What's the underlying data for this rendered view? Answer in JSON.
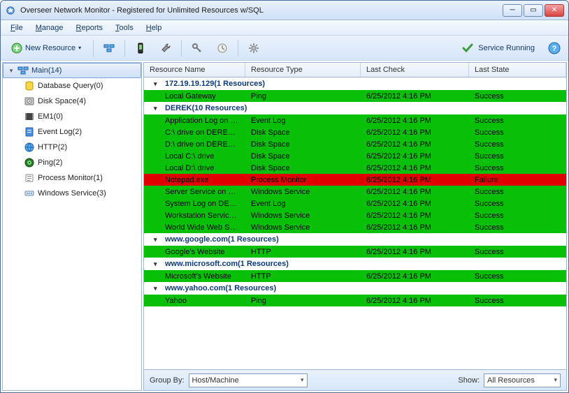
{
  "window": {
    "title": "Overseer Network Monitor - Registered for Unlimited Resources w/SQL"
  },
  "menu": {
    "file": "File",
    "manage": "Manage",
    "reports": "Reports",
    "tools": "Tools",
    "help": "Help"
  },
  "toolbar": {
    "new_resource": "New Resource",
    "service_status": "Service Running"
  },
  "sidebar": {
    "root": "Main(14)",
    "items": [
      {
        "label": "Database Query(0)",
        "icon": "db"
      },
      {
        "label": "Disk Space(4)",
        "icon": "disk"
      },
      {
        "label": "EM1(0)",
        "icon": "film"
      },
      {
        "label": "Event Log(2)",
        "icon": "log"
      },
      {
        "label": "HTTP(2)",
        "icon": "globe"
      },
      {
        "label": "Ping(2)",
        "icon": "ping"
      },
      {
        "label": "Process Monitor(1)",
        "icon": "proc"
      },
      {
        "label": "Windows Service(3)",
        "icon": "svc"
      }
    ]
  },
  "grid": {
    "columns": {
      "name": "Resource Name",
      "type": "Resource Type",
      "check": "Last Check",
      "state": "Last State"
    },
    "groups": [
      {
        "title": "172.19.19.129(1 Resources)",
        "rows": [
          {
            "name": "Local Gateway",
            "type": "Ping",
            "check": "6/25/2012 4:16 PM",
            "state": "Success",
            "status": "success"
          }
        ]
      },
      {
        "title": "DEREK(10 Resources)",
        "rows": [
          {
            "name": "Application Log on DEREK",
            "type": "Event Log",
            "check": "6/25/2012 4:16 PM",
            "state": "Success",
            "status": "success"
          },
          {
            "name": "C:\\ drive on DEREK via ...",
            "type": "Disk Space",
            "check": "6/25/2012 4:16 PM",
            "state": "Success",
            "status": "success"
          },
          {
            "name": "D:\\ drive on DEREK via ...",
            "type": "Disk Space",
            "check": "6/25/2012 4:16 PM",
            "state": "Success",
            "status": "success"
          },
          {
            "name": "Local C:\\ drive",
            "type": "Disk Space",
            "check": "6/25/2012 4:16 PM",
            "state": "Success",
            "status": "success"
          },
          {
            "name": "Local D:\\ drive",
            "type": "Disk Space",
            "check": "6/25/2012 4:16 PM",
            "state": "Success",
            "status": "success"
          },
          {
            "name": "Notepad.exe",
            "type": "Process Monitor",
            "check": "6/25/2012 4:16 PM",
            "state": "Failure",
            "status": "failure"
          },
          {
            "name": "Server Service on DEREK",
            "type": "Windows Service",
            "check": "6/25/2012 4:16 PM",
            "state": "Success",
            "status": "success"
          },
          {
            "name": "System Log on DEREK",
            "type": "Event Log",
            "check": "6/25/2012 4:16 PM",
            "state": "Success",
            "status": "success"
          },
          {
            "name": "Workstation Service on...",
            "type": "Windows Service",
            "check": "6/25/2012 4:16 PM",
            "state": "Success",
            "status": "success"
          },
          {
            "name": "World Wide Web Servic...",
            "type": "Windows Service",
            "check": "6/25/2012 4:16 PM",
            "state": "Success",
            "status": "success"
          }
        ]
      },
      {
        "title": "www.google.com(1 Resources)",
        "rows": [
          {
            "name": "Google's Website",
            "type": "HTTP",
            "check": "6/25/2012 4:16 PM",
            "state": "Success",
            "status": "success"
          }
        ]
      },
      {
        "title": "www.microsoft.com(1 Resources)",
        "rows": [
          {
            "name": "Microsoft's Website",
            "type": "HTTP",
            "check": "6/25/2012 4:16 PM",
            "state": "Success",
            "status": "success"
          }
        ]
      },
      {
        "title": "www.yahoo.com(1 Resources)",
        "rows": [
          {
            "name": "Yahoo",
            "type": "Ping",
            "check": "6/25/2012 4:16 PM",
            "state": "Success",
            "status": "success"
          }
        ]
      }
    ]
  },
  "bottom": {
    "group_by_label": "Group By:",
    "group_by_value": "Host/Machine",
    "show_label": "Show:",
    "show_value": "All Resources"
  },
  "icons": {
    "db": "<svg width='16' height='16' viewBox='0 0 16 16'><ellipse cx='8' cy='4' rx='5' ry='2' fill='#f7d64a' stroke='#b89400'/><path d='M3 4v8c0 1.1 2.2 2 5 2s5-.9 5-2V4' fill='#f7d64a' stroke='#b89400'/></svg>",
    "disk": "<svg width='16' height='16' viewBox='0 0 16 16'><rect x='2' y='3' width='12' height='10' rx='1' fill='#c9c9c9' stroke='#777'/><circle cx='8' cy='8' r='3' fill='#eee' stroke='#777'/><circle cx='8' cy='8' r='1' fill='#777'/></svg>",
    "film": "<svg width='16' height='16' viewBox='0 0 16 16'><rect x='2' y='3' width='12' height='10' fill='#444'/><rect x='2' y='3' width='2' height='10' fill='#888'/><rect x='12' y='3' width='2' height='10' fill='#888'/></svg>",
    "log": "<svg width='16' height='16' viewBox='0 0 16 16'><rect x='3' y='2' width='10' height='12' rx='1' fill='#4a90e2' stroke='#2a5ca8'/><rect x='5' y='5' width='6' height='1' fill='#fff'/><rect x='5' y='8' width='6' height='1' fill='#fff'/></svg>",
    "globe": "<svg width='16' height='16' viewBox='0 0 16 16'><circle cx='8' cy='8' r='6' fill='#5ab0ee' stroke='#1e5fa8'/><path d='M2 8h12M8 2c3 3 3 9 0 12M8 2c-3 3-3 9 0 12' stroke='#1e5fa8' fill='none'/></svg>",
    "ping": "<svg width='16' height='16' viewBox='0 0 16 16'><circle cx='8' cy='8' r='6' fill='#2a7a2a' stroke='#0d4d0d'/><circle cx='8' cy='8' r='3' fill='#7dd87d'/><circle cx='8' cy='8' r='1' fill='#0d4d0d'/></svg>",
    "proc": "<svg width='16' height='16' viewBox='0 0 16 16'><rect x='3' y='3' width='10' height='10' rx='1' fill='#fff' stroke='#888'/><rect x='5' y='5' width='6' height='1' fill='#888'/><rect x='5' y='8' width='6' height='1' fill='#888'/><rect x='5' y='11' width='4' height='1' fill='#888'/></svg>",
    "svc": "<svg width='16' height='16' viewBox='0 0 16 16'><rect x='2' y='5' width='12' height='6' rx='1' fill='#d9e7f7' stroke='#6a89b5'/><circle cx='5' cy='8' r='1' fill='#6a89b5'/><circle cx='8' cy='8' r='1' fill='#6a89b5'/><circle cx='11' cy='8' r='1' fill='#6a89b5'/></svg>",
    "app": "<svg width='14' height='14' viewBox='0 0 16 16'><circle cx='8' cy='8' r='6' fill='#5a9fe2' stroke='#2a5ca8'/><path d='M8 3l1.5 3H13l-2.5 2 1 3.5L8 10l-3.5 1.5 1-3.5L3 6h3.5z' fill='#fff'/></svg>",
    "plus": "<svg width='16' height='16' viewBox='0 0 16 16'><circle cx='8' cy='8' r='7' fill='#7dd87d' stroke='#2a7a2a'/><path d='M8 4v8M4 8h8' stroke='#fff' stroke-width='2'/></svg>",
    "check": "<svg width='18' height='18' viewBox='0 0 18 18'><path d='M3 9l4 4 8-9' stroke='#3a9b3a' stroke-width='3' fill='none' stroke-linecap='round'/></svg>",
    "help": "<svg width='18' height='18' viewBox='0 0 18 18'><circle cx='9' cy='9' r='8' fill='#5ab0ee' stroke='#1e5fa8'/><text x='9' y='13' text-anchor='middle' fill='#fff' font-size='11' font-weight='bold'>?</text></svg>",
    "group": "<svg width='16' height='16' viewBox='0 0 16 16'><rect x='1' y='3' width='6' height='4' fill='#5ab0ee' stroke='#1e5fa8'/><rect x='9' y='3' width='6' height='4' fill='#5ab0ee' stroke='#1e5fa8'/><rect x='5' y='9' width='6' height='4' fill='#5ab0ee' stroke='#1e5fa8'/></svg>",
    "phone": "<svg width='16' height='16' viewBox='0 0 16 16'><rect x='5' y='1' width='6' height='14' rx='1' fill='#333' stroke='#000'/><rect x='6' y='3' width='4' height='7' fill='#7dd87d'/></svg>",
    "tools": "<svg width='16' height='16' viewBox='0 0 16 16'><path d='M11 2a3 3 0 00-3 3l-5 5 3 3 5-5a3 3 0 003-3l-2 2-2-2z' fill='#999' stroke='#555'/></svg>",
    "key": "<svg width='16' height='16' viewBox='0 0 16 16'><circle cx='5' cy='5' r='3' fill='none' stroke='#777' stroke-width='2'/><path d='M7 7l6 6M11 13l2-2' stroke='#777' stroke-width='2'/></svg>",
    "clock": "<svg width='16' height='16' viewBox='0 0 16 16'><circle cx='8' cy='8' r='6' fill='#eee' stroke='#888'/><path d='M8 4v4l3 2' stroke='#555' fill='none'/></svg>",
    "gear": "<svg width='16' height='16' viewBox='0 0 16 16'><circle cx='8' cy='8' r='3' fill='#bbb' stroke='#777'/><path d='M8 1v3M8 12v3M1 8h3M12 8h3M3 3l2 2M11 11l2 2M13 3l-2 2M5 11l-2 2' stroke='#777' stroke-width='1.5'/></svg>"
  }
}
